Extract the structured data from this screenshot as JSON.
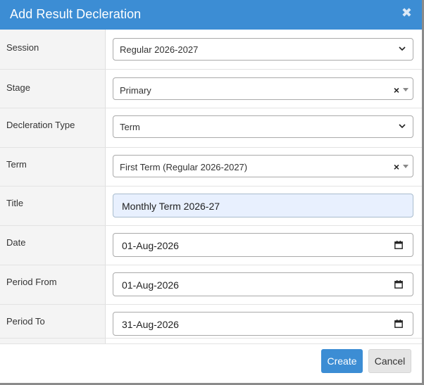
{
  "dialog": {
    "title": "Add Result Decleration",
    "close_icon": "close-icon"
  },
  "fields": {
    "session": {
      "label": "Session",
      "value": "Regular 2026-2027"
    },
    "stage": {
      "label": "Stage",
      "value": "Primary",
      "clear": "×"
    },
    "decleration_type": {
      "label": "Decleration Type",
      "value": "Term"
    },
    "term": {
      "label": "Term",
      "value": "First Term (Regular 2026-2027)",
      "clear": "×"
    },
    "title": {
      "label": "Title",
      "value": "Monthly Term 2026-27"
    },
    "date": {
      "label": "Date",
      "value": "01-Aug-2026"
    },
    "period_from": {
      "label": "Period From",
      "value": "01-Aug-2026"
    },
    "period_to": {
      "label": "Period To",
      "value": "31-Aug-2026"
    }
  },
  "footer": {
    "create_label": "Create",
    "cancel_label": "Cancel"
  },
  "colors": {
    "header": "#3c8dd4",
    "primary_button": "#3c8dd4",
    "autofill_bg": "#e8f0fe"
  }
}
